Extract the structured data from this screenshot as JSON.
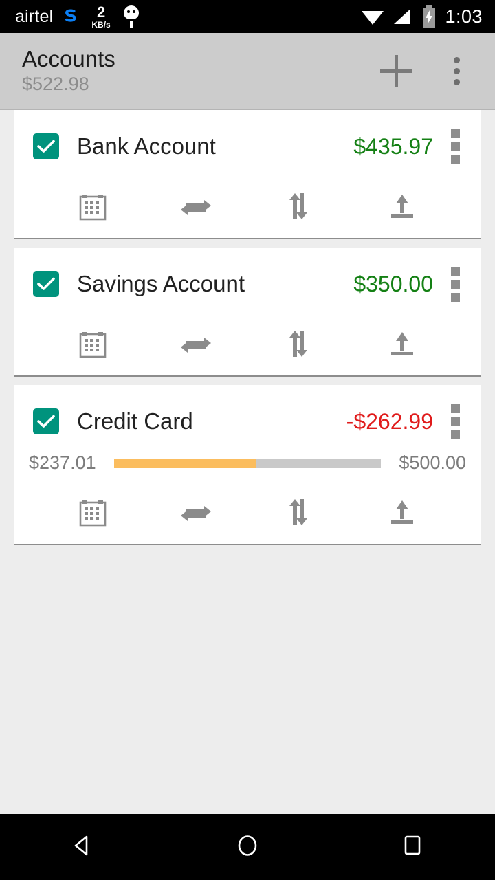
{
  "status_bar": {
    "carrier": "airtel",
    "skype_icon": "skype-icon",
    "net_speed_value": "2",
    "net_speed_unit": "KB/s",
    "robot_icon": "android-head-icon",
    "wifi_icon": "wifi-full-icon",
    "signal_icon": "cell-signal-icon",
    "battery_icon": "battery-charging-icon",
    "time": "1:03"
  },
  "toolbar": {
    "title": "Accounts",
    "total_balance": "$522.98",
    "add_icon": "plus-icon",
    "overflow_icon": "overflow-menu-icon"
  },
  "accounts": [
    {
      "name": "Bank Account",
      "balance": "$435.97",
      "balance_sign": "positive",
      "checked": true,
      "has_limit_bar": false
    },
    {
      "name": "Savings Account",
      "balance": "$350.00",
      "balance_sign": "positive",
      "checked": true,
      "has_limit_bar": false
    },
    {
      "name": "Credit Card",
      "balance": "-$262.99",
      "balance_sign": "negative",
      "checked": true,
      "has_limit_bar": true,
      "available": "$237.01",
      "limit": "$500.00",
      "used_percent": 53
    }
  ],
  "account_actions": [
    {
      "icon": "calendar-icon",
      "label": "Calendar"
    },
    {
      "icon": "recurring-icon",
      "label": "Recurring"
    },
    {
      "icon": "transfer-icon",
      "label": "Transfer"
    },
    {
      "icon": "export-icon",
      "label": "Export"
    }
  ],
  "nav_bar": {
    "back_icon": "back-triangle-icon",
    "home_icon": "home-circle-icon",
    "recents_icon": "recents-square-icon"
  },
  "colors": {
    "checkbox_teal": "#00937d",
    "positive_green": "#148014",
    "negative_red": "#e01b1b",
    "progress_orange": "#fbbd5e",
    "progress_track": "#c9c9c9",
    "toolbar_gray": "#cccccc",
    "page_background": "#ededed"
  }
}
